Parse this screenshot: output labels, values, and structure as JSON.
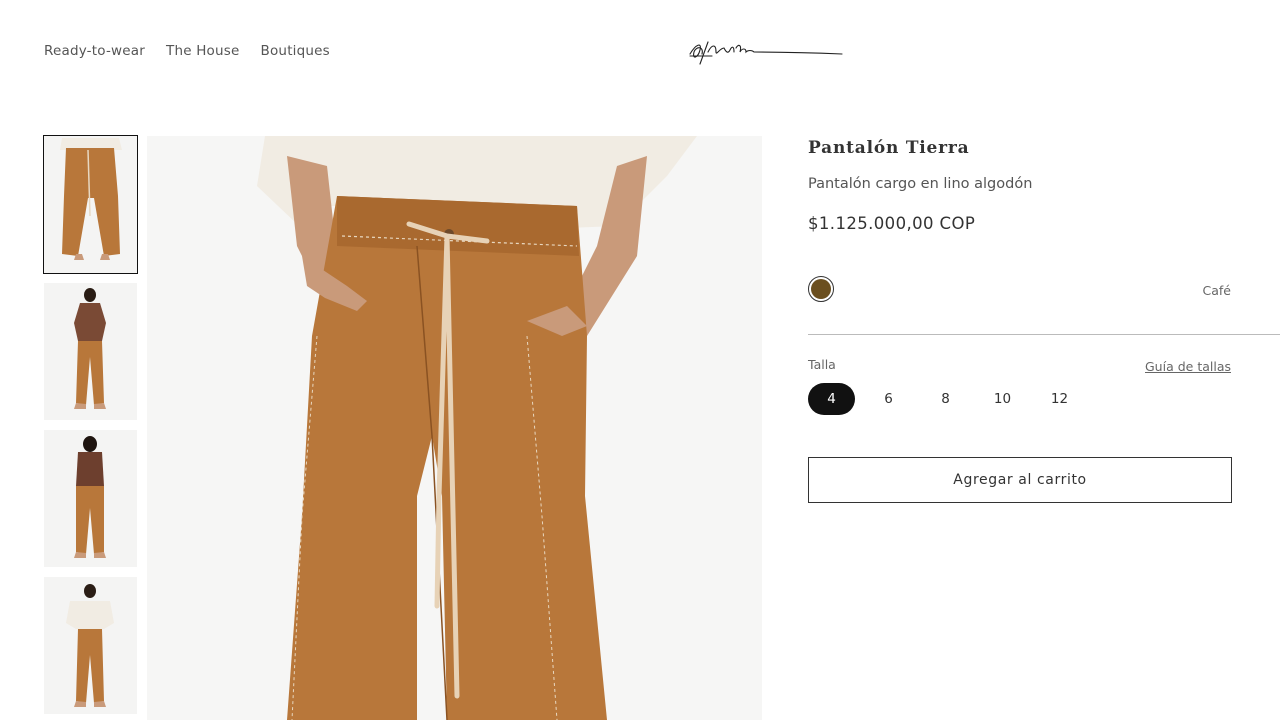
{
  "nav": {
    "items": [
      "Ready-to-wear",
      "The House",
      "Boutiques"
    ]
  },
  "brand": {
    "logo_icon": "signature-logo"
  },
  "gallery": {
    "thumbnails": [
      {
        "icon": "pants-front-closeup",
        "selected": true
      },
      {
        "icon": "model-front-brown-top",
        "selected": false
      },
      {
        "icon": "model-back-brown-top",
        "selected": false
      },
      {
        "icon": "model-front-white-top",
        "selected": false
      }
    ],
    "main_image": "pants-front-closeup"
  },
  "product": {
    "title": "Pantalón Tierra",
    "subtitle": "Pantalón cargo en lino algodón",
    "price": "$1.125.000,00 COP",
    "color": {
      "name": "Café",
      "swatch_hex": "#6b4f1f"
    },
    "size": {
      "label": "Talla",
      "guide_link": "Guía de tallas",
      "options": [
        "4",
        "6",
        "8",
        "10",
        "12"
      ],
      "selected": "4"
    },
    "add_to_cart": "Agregar al carrito"
  },
  "colors": {
    "pants": "#b8773a",
    "shirt": "#f1ece3",
    "skin": "#c99a7a",
    "accent_dark": "#111111"
  }
}
